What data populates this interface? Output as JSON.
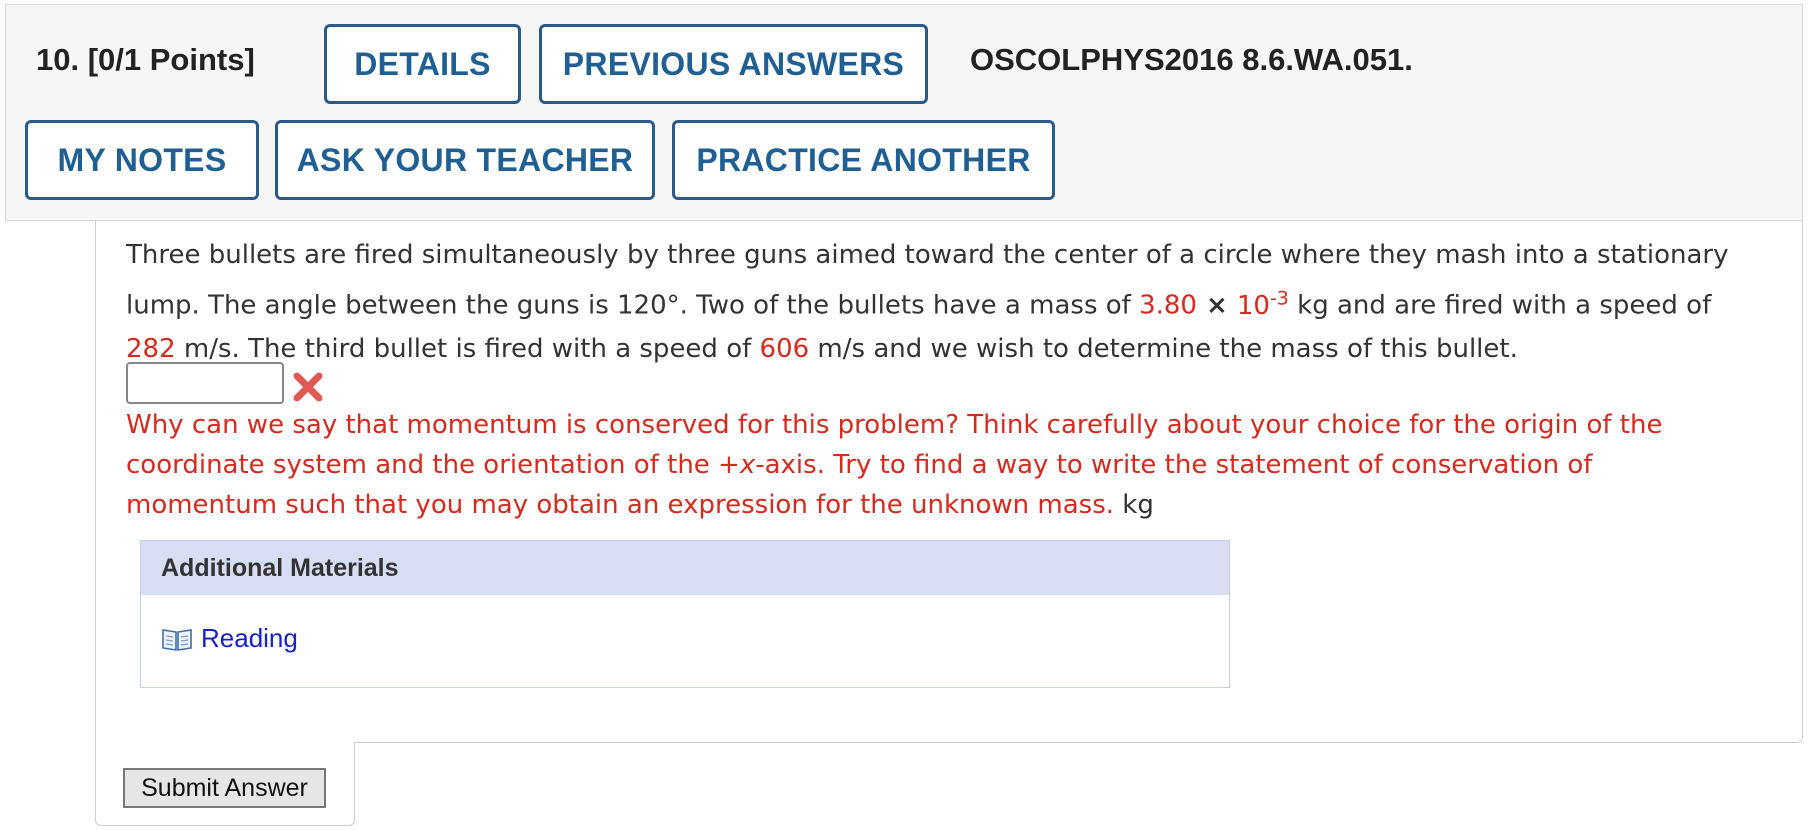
{
  "header": {
    "question_label": "10.  [0/1 Points]",
    "details_label": "DETAILS",
    "previous_answers_label": "PREVIOUS ANSWERS",
    "question_id": "OSCOLPHYS2016 8.6.WA.051.",
    "my_notes_label": "MY NOTES",
    "ask_teacher_label": "ASK YOUR TEACHER",
    "practice_another_label": "PRACTICE ANOTHER"
  },
  "question": {
    "line1": "Three bullets are fired simultaneously by three guns aimed toward the center of a circle where they mash into a stationary",
    "line2_a": "lump. The angle between the guns is 120°. Two of the bullets have a mass of ",
    "mass_value": "3.80",
    "times": " × ",
    "mass_base": "10",
    "mass_exp": "-3",
    "line2_b": " kg and are fired with a speed of",
    "speed1": "282",
    "line3_a": " m/s. The third bullet is fired with a speed of ",
    "speed2": "606",
    "line3_b": " m/s and we wish to determine the mass of this bullet."
  },
  "answer": {
    "value": "",
    "status": "incorrect",
    "icon": "x-mark-icon"
  },
  "feedback": {
    "line1": "Why can we say that momentum is conserved for this problem? Think carefully about your choice for the origin of the",
    "line2_a": "coordinate system and the orientation of the +",
    "line2_var": "x",
    "line2_b": "-axis. Try to find a way to write the statement of conservation of",
    "line3": "momentum such that you may obtain an expression for the unknown mass.",
    "unit": " kg"
  },
  "additional_materials": {
    "title": "Additional Materials",
    "items": [
      {
        "label": "Reading",
        "icon": "book-icon"
      }
    ]
  },
  "submit": {
    "label": "Submit Answer"
  },
  "colors": {
    "button_border": "#2a5a8c",
    "button_text": "#1f5f94",
    "highlight_red": "#d62a1e",
    "link_blue": "#1522c8",
    "materials_header": "#d7ddf2"
  }
}
